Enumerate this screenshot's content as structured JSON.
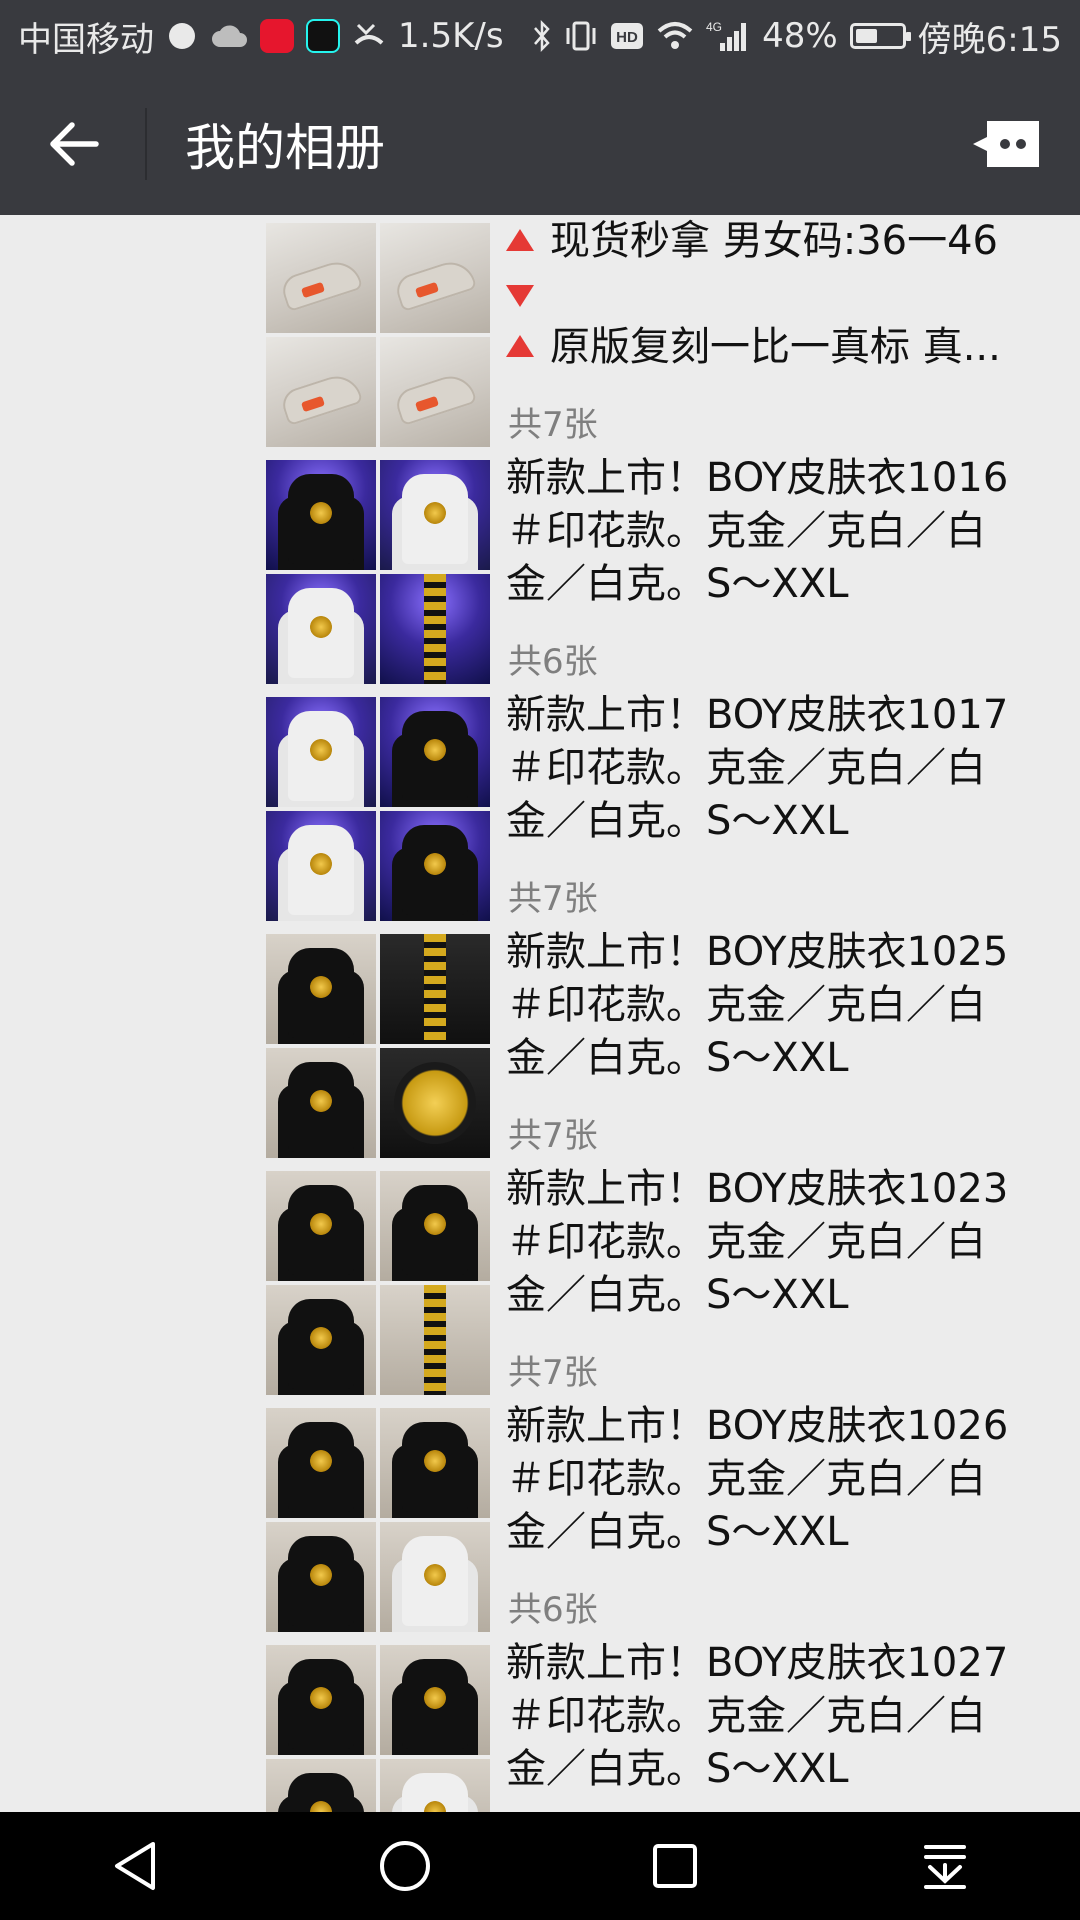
{
  "status_bar": {
    "carrier": "中国移动",
    "net_speed": "1.5K/s",
    "network_type": "4G",
    "battery": "48%",
    "battery_level": 0.48,
    "time": "傍晚6:15",
    "icons": [
      "firefox-icon",
      "cloud-icon",
      "weibo-icon",
      "tiktok-icon",
      "missed-call-icon",
      "bluetooth-icon",
      "vibrate-icon",
      "hd-icon",
      "wifi-icon",
      "signal-icon",
      "battery-icon"
    ]
  },
  "header": {
    "title": "我的相册",
    "back_icon": "arrow-left-icon",
    "more_icon": "more-icon"
  },
  "colors": {
    "bar": "#393a3f",
    "background": "#ececec",
    "accent_red": "#e53935",
    "text": "#121212",
    "muted": "#7f7f7f"
  },
  "albums": [
    {
      "lines": [
        "现货秒拿 男女码:36一46",
        "",
        "原版复刻一比一真标 真..."
      ],
      "markers": [
        "up",
        "down",
        "up"
      ],
      "count": "共7张",
      "thumbs": [
        "sneaker",
        "sneaker",
        "sneaker",
        "sneaker"
      ]
    },
    {
      "lines": [
        "新款上市！BOY皮肤衣1016",
        "＃印花款。克金／克白／白",
        "金／白克。S～XXL"
      ],
      "count": "共6张",
      "thumbs": [
        "purple-black-jacket",
        "purple-white-jacket",
        "purple-white-jacket",
        "purple-stripe"
      ]
    },
    {
      "lines": [
        "新款上市！BOY皮肤衣1017",
        "＃印花款。克金／克白／白",
        "金／白克。S～XXL"
      ],
      "count": "共7张",
      "thumbs": [
        "purple-white-jacket",
        "purple-black-jacket",
        "purple-white-jacket",
        "purple-black-jacket"
      ]
    },
    {
      "lines": [
        "新款上市！BOY皮肤衣1025",
        "＃印花款。克金／克白／白",
        "金／白克。S～XXL"
      ],
      "count": "共7张",
      "thumbs": [
        "wall-black-jacket",
        "dark-stripe",
        "wall-black-jacket",
        "dark-emblem"
      ]
    },
    {
      "lines": [
        "新款上市！BOY皮肤衣1023",
        "＃印花款。克金／克白／白",
        "金／白克。S～XXL"
      ],
      "count": "共7张",
      "thumbs": [
        "wall-black-jacket",
        "wall-black-jacket",
        "wall-black-jacket",
        "wall-stripe"
      ]
    },
    {
      "lines": [
        "新款上市！BOY皮肤衣1026",
        "＃印花款。克金／克白／白",
        "金／白克。S～XXL"
      ],
      "count": "共6张",
      "thumbs": [
        "wall-black-jacket",
        "wall-black-jacket",
        "wall-black-jacket",
        "wall-white-jacket"
      ]
    },
    {
      "lines": [
        "新款上市！BOY皮肤衣1027",
        "＃印花款。克金／克白／白",
        "金／白克。S～XXL"
      ],
      "count": "",
      "thumbs": [
        "wall-black-jacket",
        "wall-black-jacket",
        "wall-black-jacket",
        "wall-white-jacket"
      ]
    }
  ],
  "nav_bar": {
    "buttons": [
      "back-triangle-icon",
      "home-circle-icon",
      "recents-square-icon",
      "notification-pull-icon"
    ]
  }
}
